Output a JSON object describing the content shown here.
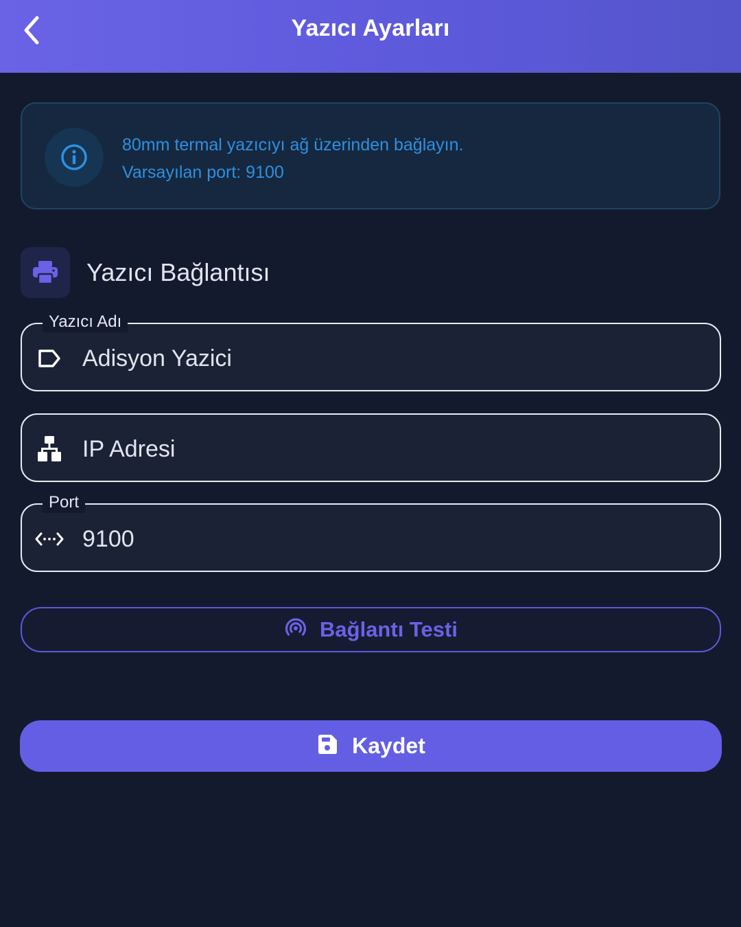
{
  "appbar": {
    "title": "Yazıcı Ayarları",
    "back_icon": "chevron-left-icon"
  },
  "info_card": {
    "icon": "info-icon",
    "line1": "80mm termal yazıcıyı ağ üzerinden bağlayın.",
    "line2": "Varsayılan port: 9100"
  },
  "section": {
    "icon": "printer-icon",
    "title": "Yazıcı Bağlantısı"
  },
  "fields": {
    "printer_name": {
      "label": "Yazıcı Adı",
      "value": "Adisyon Yazici",
      "icon": "label-tag-icon"
    },
    "ip_address": {
      "placeholder": "IP Adresi",
      "value": "",
      "icon": "network-icon"
    },
    "port": {
      "label": "Port",
      "value": "9100",
      "icon": "port-arrows-icon"
    }
  },
  "buttons": {
    "test_label": "Bağlantı Testi",
    "test_icon": "broadcast-icon",
    "save_label": "Kaydet",
    "save_icon": "save-icon"
  },
  "colors": {
    "appbar": "#6a63e6",
    "accent": "#635ee4",
    "background": "#141a2e",
    "info_text": "#2f8fe0"
  }
}
